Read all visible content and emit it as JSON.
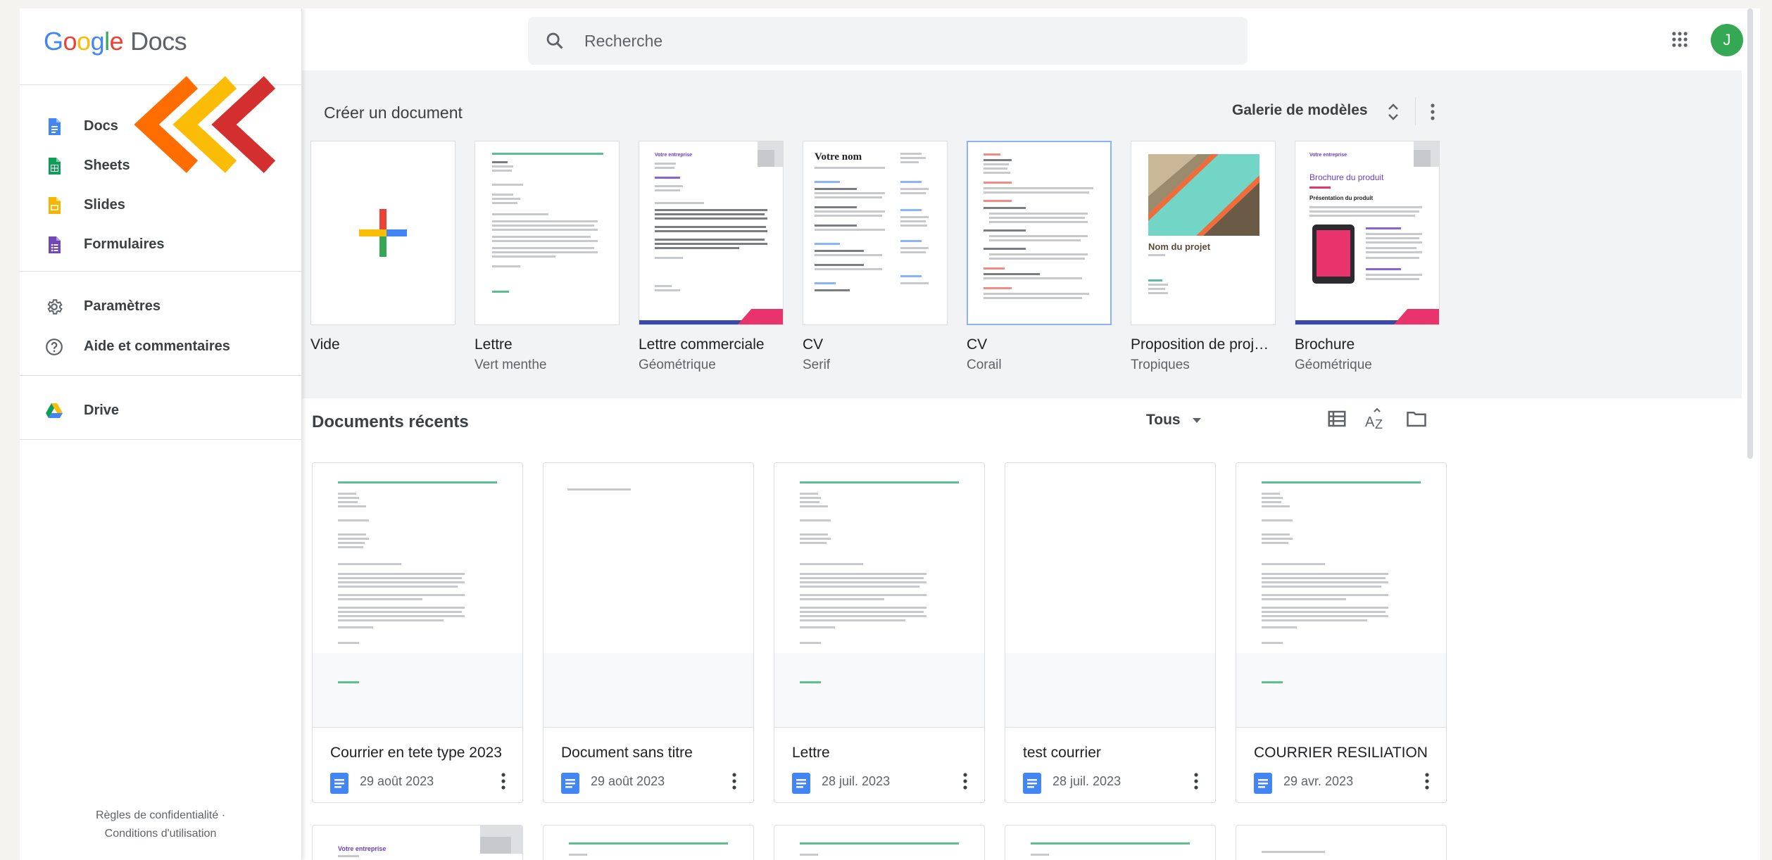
{
  "app": {
    "logo_word": "Google",
    "product": "Docs"
  },
  "sidebar": {
    "apps": [
      {
        "label": "Docs",
        "icon": "docs-icon",
        "color": "#4285f4"
      },
      {
        "label": "Sheets",
        "icon": "sheets-icon",
        "color": "#0f9d58"
      },
      {
        "label": "Slides",
        "icon": "slides-icon",
        "color": "#f4b400"
      },
      {
        "label": "Formulaires",
        "icon": "forms-icon",
        "color": "#7248b9"
      }
    ],
    "settings": [
      {
        "label": "Paramètres",
        "icon": "gear-icon"
      },
      {
        "label": "Aide et commentaires",
        "icon": "help-icon"
      }
    ],
    "drive": {
      "label": "Drive",
      "icon": "drive-icon"
    },
    "footer": {
      "privacy": "Règles de confidentialité",
      "separator": "·",
      "terms": "Conditions d'utilisation"
    }
  },
  "header": {
    "search_placeholder": "Recherche",
    "avatar_letter": "J",
    "avatar_color": "#34a853"
  },
  "gallery": {
    "title": "Créer un document",
    "models_label": "Galerie de modèles",
    "templates": [
      {
        "name": "Vide",
        "sub": ""
      },
      {
        "name": "Lettre",
        "sub": "Vert menthe"
      },
      {
        "name": "Lettre commerciale",
        "sub": "Géométrique"
      },
      {
        "name": "CV",
        "sub": "Serif"
      },
      {
        "name": "CV",
        "sub": "Corail"
      },
      {
        "name": "Proposition de proj…",
        "sub": "Tropiques"
      },
      {
        "name": "Brochure",
        "sub": "Géométrique"
      }
    ],
    "thumb_text": {
      "cv_serif_name": "Votre nom",
      "proposal_title": "Nom du projet",
      "brochure_company": "Votre entreprise",
      "brochure_title": "Brochure du produit",
      "brochure_section": "Présentation du produit",
      "commercial_company": "Votre entreprise"
    }
  },
  "recent": {
    "title": "Documents récents",
    "owner_filter": "Tous",
    "docs": [
      {
        "name": "Courrier en tete type 2023",
        "date": "29 août 2023"
      },
      {
        "name": "Document sans titre",
        "date": "29 août 2023"
      },
      {
        "name": "Lettre",
        "date": "28 juil. 2023"
      },
      {
        "name": "test courrier",
        "date": "28 juil. 2023"
      },
      {
        "name": "COURRIER RESILIATION",
        "date": "29 avr. 2023"
      }
    ],
    "partial_row": [
      {
        "snippet": "Votre entreprise"
      }
    ]
  },
  "annotation": {
    "arrow_colors": [
      "#ff6d00",
      "#fbbc05",
      "#d32f2f"
    ]
  }
}
